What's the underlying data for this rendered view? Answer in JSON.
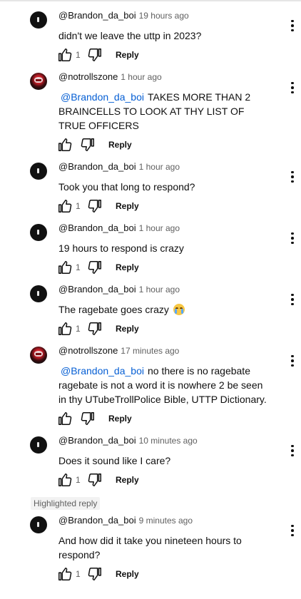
{
  "comments": [
    {
      "author": "@Brandon_da_boi",
      "time": "19 hours ago",
      "avatar": "dark",
      "mention": "",
      "text": "didn't we leave the uttp in 2023?",
      "likes": "1",
      "reply_label": "Reply"
    },
    {
      "author": "@notrollszone",
      "time": "1 hour ago",
      "avatar": "red",
      "mention": "@Brandon_da_boi",
      "text": "TAKES MORE THAN 2 BRAINCELLS TO LOOK AT THY LIST OF TRUE OFFICERS",
      "likes": "",
      "reply_label": "Reply"
    },
    {
      "author": "@Brandon_da_boi",
      "time": "1 hour ago",
      "avatar": "dark",
      "mention": "",
      "text": "Took you that long to respond?",
      "likes": "1",
      "reply_label": "Reply"
    },
    {
      "author": "@Brandon_da_boi",
      "time": "1 hour ago",
      "avatar": "dark",
      "mention": "",
      "text": "19 hours to respond is crazy",
      "likes": "1",
      "reply_label": "Reply"
    },
    {
      "author": "@Brandon_da_boi",
      "time": "1 hour ago",
      "avatar": "dark",
      "mention": "",
      "text": "The ragebate goes crazy",
      "emoji": "loudly-crying-face-emoji",
      "likes": "1",
      "reply_label": "Reply"
    },
    {
      "author": "@notrollszone",
      "time": "17 minutes ago",
      "avatar": "red",
      "mention": "@Brandon_da_boi",
      "text": "no there is no ragebate ragebate is not a word it is nowhere 2 be seen in thy UTubeTrollPolice Bible, UTTP Dictionary.",
      "likes": "",
      "reply_label": "Reply"
    },
    {
      "author": "@Brandon_da_boi",
      "time": "10 minutes ago",
      "avatar": "dark",
      "mention": "",
      "text": "Does it sound like I care?",
      "likes": "1",
      "reply_label": "Reply"
    },
    {
      "author": "@Brandon_da_boi",
      "time": "9 minutes ago",
      "avatar": "dark",
      "mention": "",
      "text": "And how did it take you nineteen hours to respond?",
      "likes": "1",
      "reply_label": "Reply"
    }
  ],
  "highlight_label": "Highlighted reply",
  "icons": {
    "like": "thumbs-up-icon",
    "dislike": "thumbs-down-icon",
    "menu": "more-vert-icon"
  }
}
